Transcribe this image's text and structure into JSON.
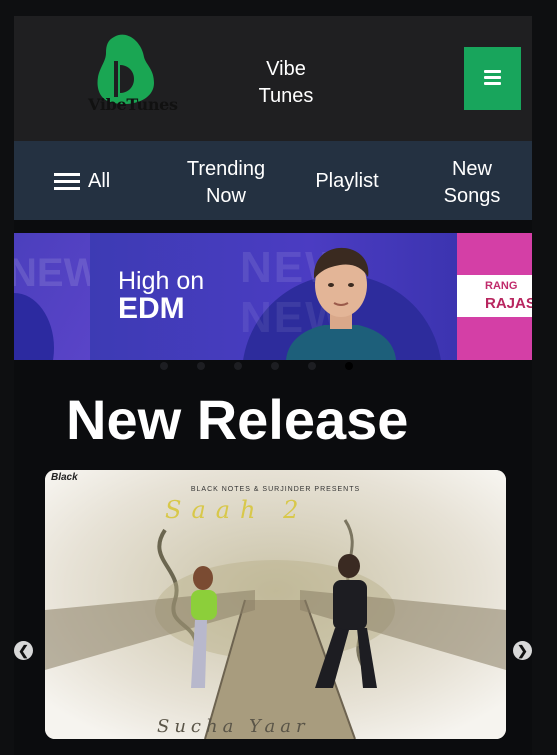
{
  "header": {
    "logo_text": "VibeTunes",
    "brand_line1": "Vibe",
    "brand_line2": "Tunes",
    "menu_icon": "hamburger-icon"
  },
  "nav": {
    "all_label": "All",
    "trending_line1": "Trending",
    "trending_line2": "Now",
    "playlist_label": "Playlist",
    "new_line1": "New",
    "new_line2": "Songs"
  },
  "banner": {
    "ghost_text": "NEW",
    "headline_line1": "High on",
    "headline_line2": "EDM",
    "right_line1": "RANG",
    "right_line2": "RAJAS",
    "slide_count": 6,
    "active_slide": 6
  },
  "section": {
    "title": "New Release"
  },
  "album": {
    "label": "Black",
    "presents": "BLACK NOTES & SURJINDER PRESENTS",
    "title": "Saah 2",
    "artist": "Sucha Yaar"
  },
  "colors": {
    "accent_green": "#18a55c",
    "nav_bg": "#243141",
    "header_bg": "#1f1f21",
    "banner_purple": "#4b3cc2",
    "banner_pink": "#d43fa6"
  }
}
